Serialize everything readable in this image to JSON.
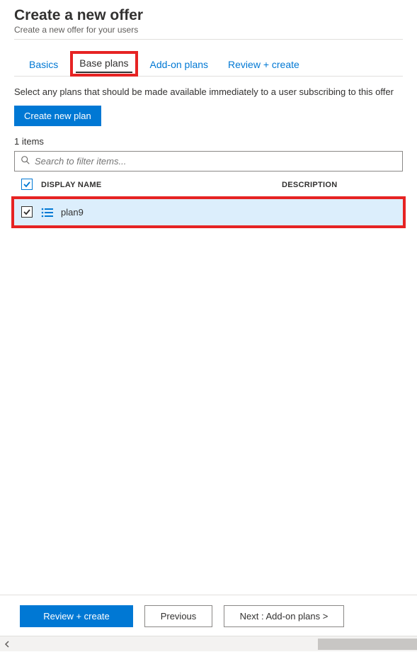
{
  "header": {
    "title": "Create a new offer",
    "subtitle": "Create a new offer for your users"
  },
  "tabs": {
    "basics": "Basics",
    "base_plans": "Base plans",
    "addon": "Add-on plans",
    "review": "Review + create"
  },
  "instruction": "Select any plans that should be made available immediately to a user subscribing to this offer",
  "create_plan_label": "Create new plan",
  "item_count": "1 items",
  "search_placeholder": "Search to filter items...",
  "columns": {
    "display_name": "DISPLAY NAME",
    "description": "DESCRIPTION"
  },
  "rows": [
    {
      "name": "plan9",
      "checked": true
    }
  ],
  "footer": {
    "review": "Review + create",
    "previous": "Previous",
    "next": "Next : Add-on plans >"
  }
}
